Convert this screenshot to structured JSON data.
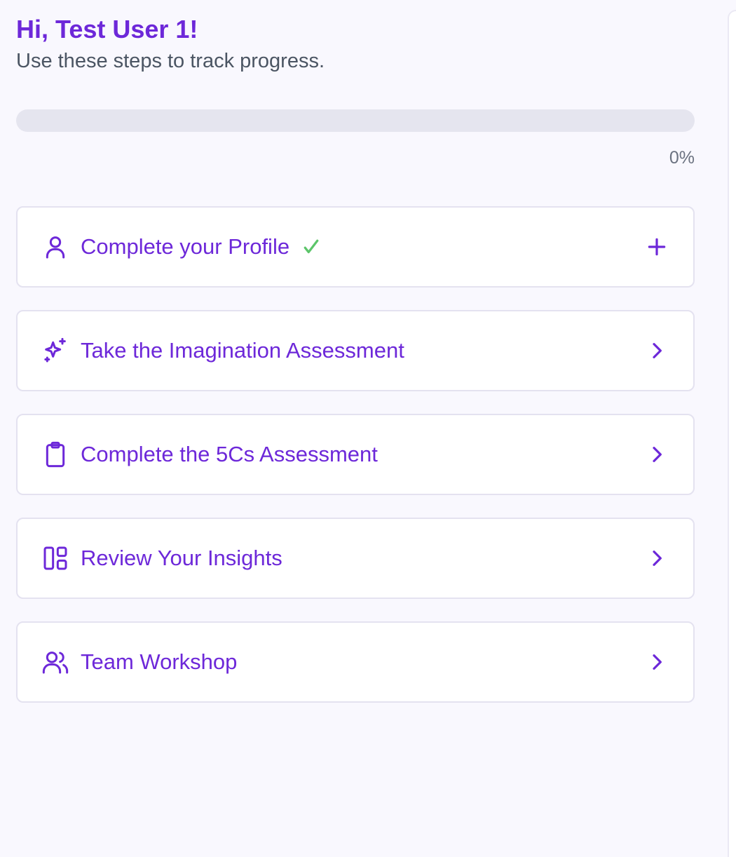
{
  "header": {
    "greeting": "Hi, Test User 1!",
    "subtitle": "Use these steps to track progress."
  },
  "progress": {
    "value": 0,
    "label": "0%",
    "fill_color": "#6d28d9",
    "track_color": "#e5e5ef"
  },
  "steps": [
    {
      "label": "Complete your Profile",
      "icon": "user-icon",
      "completed": true,
      "action_icon": "plus-icon"
    },
    {
      "label": "Take the Imagination Assessment",
      "icon": "sparkles-icon",
      "completed": false,
      "action_icon": "chevron-right-icon"
    },
    {
      "label": "Complete the 5Cs Assessment",
      "icon": "clipboard-icon",
      "completed": false,
      "action_icon": "chevron-right-icon"
    },
    {
      "label": "Review Your Insights",
      "icon": "layout-dashboard-icon",
      "completed": false,
      "action_icon": "chevron-right-icon"
    },
    {
      "label": "Team Workshop",
      "icon": "users-icon",
      "completed": false,
      "action_icon": "chevron-right-icon"
    }
  ],
  "colors": {
    "accent": "#6d28d9",
    "check": "#5cc56a",
    "background": "#f9f8fe",
    "muted_text": "#4b5563"
  }
}
